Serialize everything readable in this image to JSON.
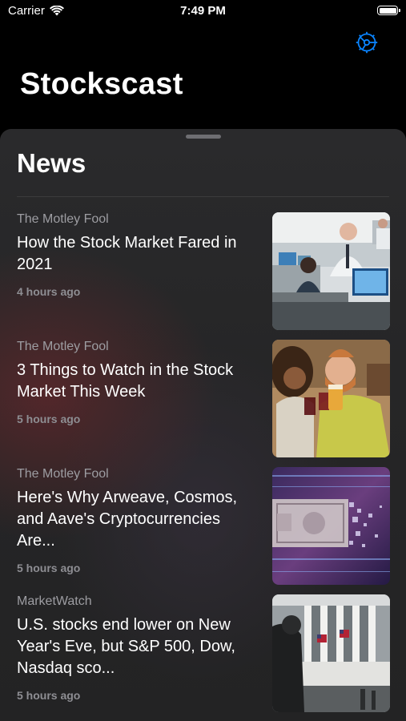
{
  "status_bar": {
    "carrier": "Carrier",
    "time": "7:49 PM"
  },
  "header": {
    "title": "Stockscast",
    "settings_icon": "gear-icon",
    "accent_color": "#0a84ff"
  },
  "news": {
    "section_title": "News",
    "items": [
      {
        "source": "The Motley Fool",
        "headline": "How the Stock Market Fared in 2021",
        "time": "4 hours ago",
        "image": "office-traders-photo"
      },
      {
        "source": "The Motley Fool",
        "headline": "3 Things to Watch in the Stock Market This Week",
        "time": "5 hours ago",
        "image": "friends-toasting-photo"
      },
      {
        "source": "The Motley Fool",
        "headline": "Here's Why Arweave, Cosmos, and Aave's Cryptocurrencies Are...",
        "time": "5 hours ago",
        "image": "digital-dollar-photo"
      },
      {
        "source": "MarketWatch",
        "headline": "U.S. stocks end lower on New Year's Eve, but S&P 500, Dow, Nasdaq sco...",
        "time": "5 hours ago",
        "image": "nyse-building-photo"
      }
    ]
  }
}
